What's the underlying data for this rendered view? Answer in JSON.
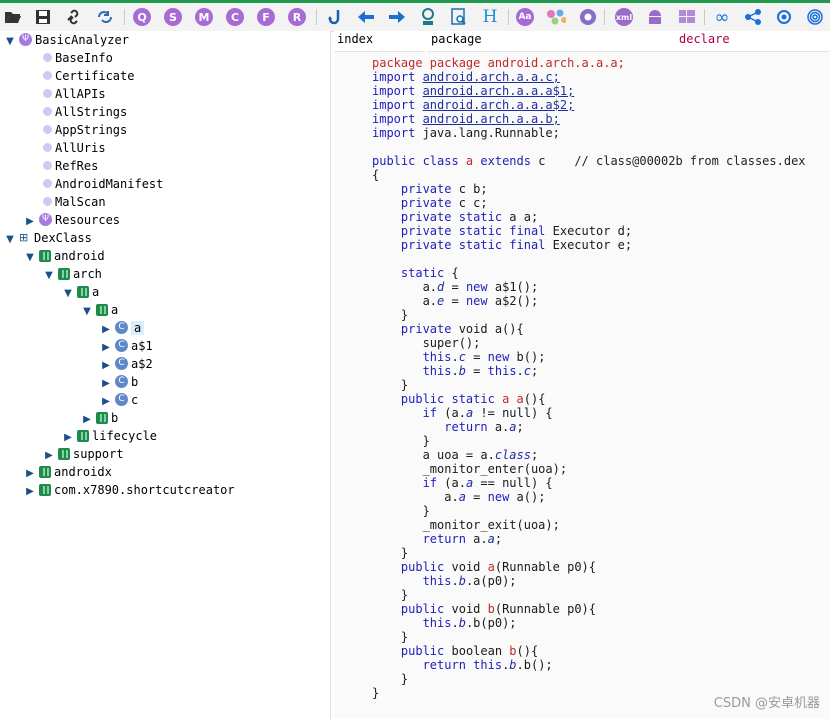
{
  "toolbar": {
    "buttons": [
      {
        "name": "open-icon"
      },
      {
        "name": "save-icon"
      },
      {
        "name": "link-icon"
      },
      {
        "name": "refresh-icon"
      },
      {
        "name": "q-icon",
        "glyph": "Q",
        "color": "#a86bd6"
      },
      {
        "name": "s-icon",
        "glyph": "S",
        "color": "#a86bd6"
      },
      {
        "name": "m-icon",
        "glyph": "M",
        "color": "#a86bd6"
      },
      {
        "name": "c-icon",
        "glyph": "C",
        "color": "#a86bd6"
      },
      {
        "name": "f-icon",
        "glyph": "F",
        "color": "#a86bd6"
      },
      {
        "name": "r-icon",
        "glyph": "R",
        "color": "#a86bd6"
      },
      {
        "name": "jump-icon"
      },
      {
        "name": "back-arrow-icon"
      },
      {
        "name": "forward-arrow-icon"
      },
      {
        "name": "person-icon"
      },
      {
        "name": "find-doc-icon"
      },
      {
        "name": "h-icon"
      },
      {
        "name": "aa-icon",
        "glyph": "Aa",
        "color": "#a86bd6"
      },
      {
        "name": "dots-icon"
      },
      {
        "name": "gear-icon"
      },
      {
        "name": "xml-icon",
        "glyph": "xml",
        "color": "#9a6bc9"
      },
      {
        "name": "android-icon"
      },
      {
        "name": "windows-icon"
      },
      {
        "name": "infinity-icon"
      },
      {
        "name": "share-icon"
      },
      {
        "name": "sun-icon"
      },
      {
        "name": "fingerprint-icon"
      }
    ]
  },
  "tree": {
    "root1": "BasicAnalyzer",
    "items": [
      "BaseInfo",
      "Certificate",
      "AllAPIs",
      "AllStrings",
      "AppStrings",
      "AllUris",
      "RefRes",
      "AndroidManifest",
      "MalScan"
    ],
    "resources": "Resources",
    "root2": "DexClass",
    "android": "android",
    "arch": "arch",
    "a1": "a",
    "a2": "a",
    "classes": [
      "a",
      "a$1",
      "a$2",
      "b",
      "c"
    ],
    "b_pkg": "b",
    "lifecycle": "lifecycle",
    "support": "support",
    "androidx": "androidx",
    "shortcut": "com.x7890.shortcutcreator"
  },
  "tabs": {
    "index": "index",
    "package": "package",
    "declare": "declare"
  },
  "code": {
    "package_line": "package android.arch.a.a.a;",
    "imports": [
      "android.arch.a.a.c;",
      "android.arch.a.a.a$1;",
      "android.arch.a.a.a$2;",
      "android.arch.a.a.b;"
    ],
    "import_plain": "java.lang.Runnable;",
    "comment": "// class@00002b from classes.dex"
  },
  "watermark": "CSDN @安卓机器"
}
